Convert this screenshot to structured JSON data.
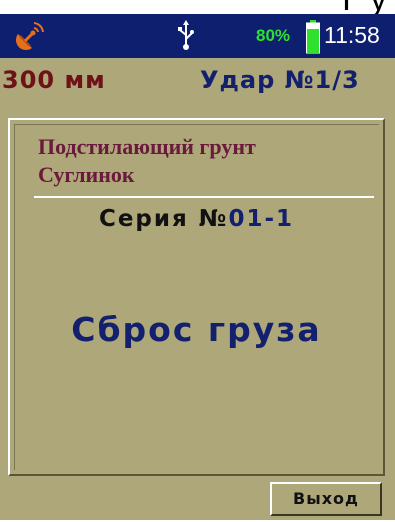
{
  "top_clip_text": "Г у",
  "status_bar": {
    "battery_percent": "80%",
    "battery_level": 0.8,
    "time": "11:58",
    "icons": [
      "satellite-icon",
      "usb-icon",
      "battery-icon"
    ],
    "colors": {
      "background": "#0f1f70",
      "battery": "#2fe02f",
      "clock": "#ffffff"
    }
  },
  "info": {
    "depth": "300 мм",
    "impact_label": "Удар №",
    "impact_value": "1/3"
  },
  "panel": {
    "soil_line1": "Подстилающий грунт",
    "soil_line2": "Суглинок",
    "series_label": "Серия №",
    "series_value": "01-1",
    "status_message": "Сброс груза"
  },
  "buttons": {
    "exit_label": "Выход"
  },
  "colors": {
    "screen_bg": "#ada77a",
    "accent_dark_red": "#6e1218",
    "accent_navy": "#12206e",
    "soil_text": "#6a1a3a"
  }
}
